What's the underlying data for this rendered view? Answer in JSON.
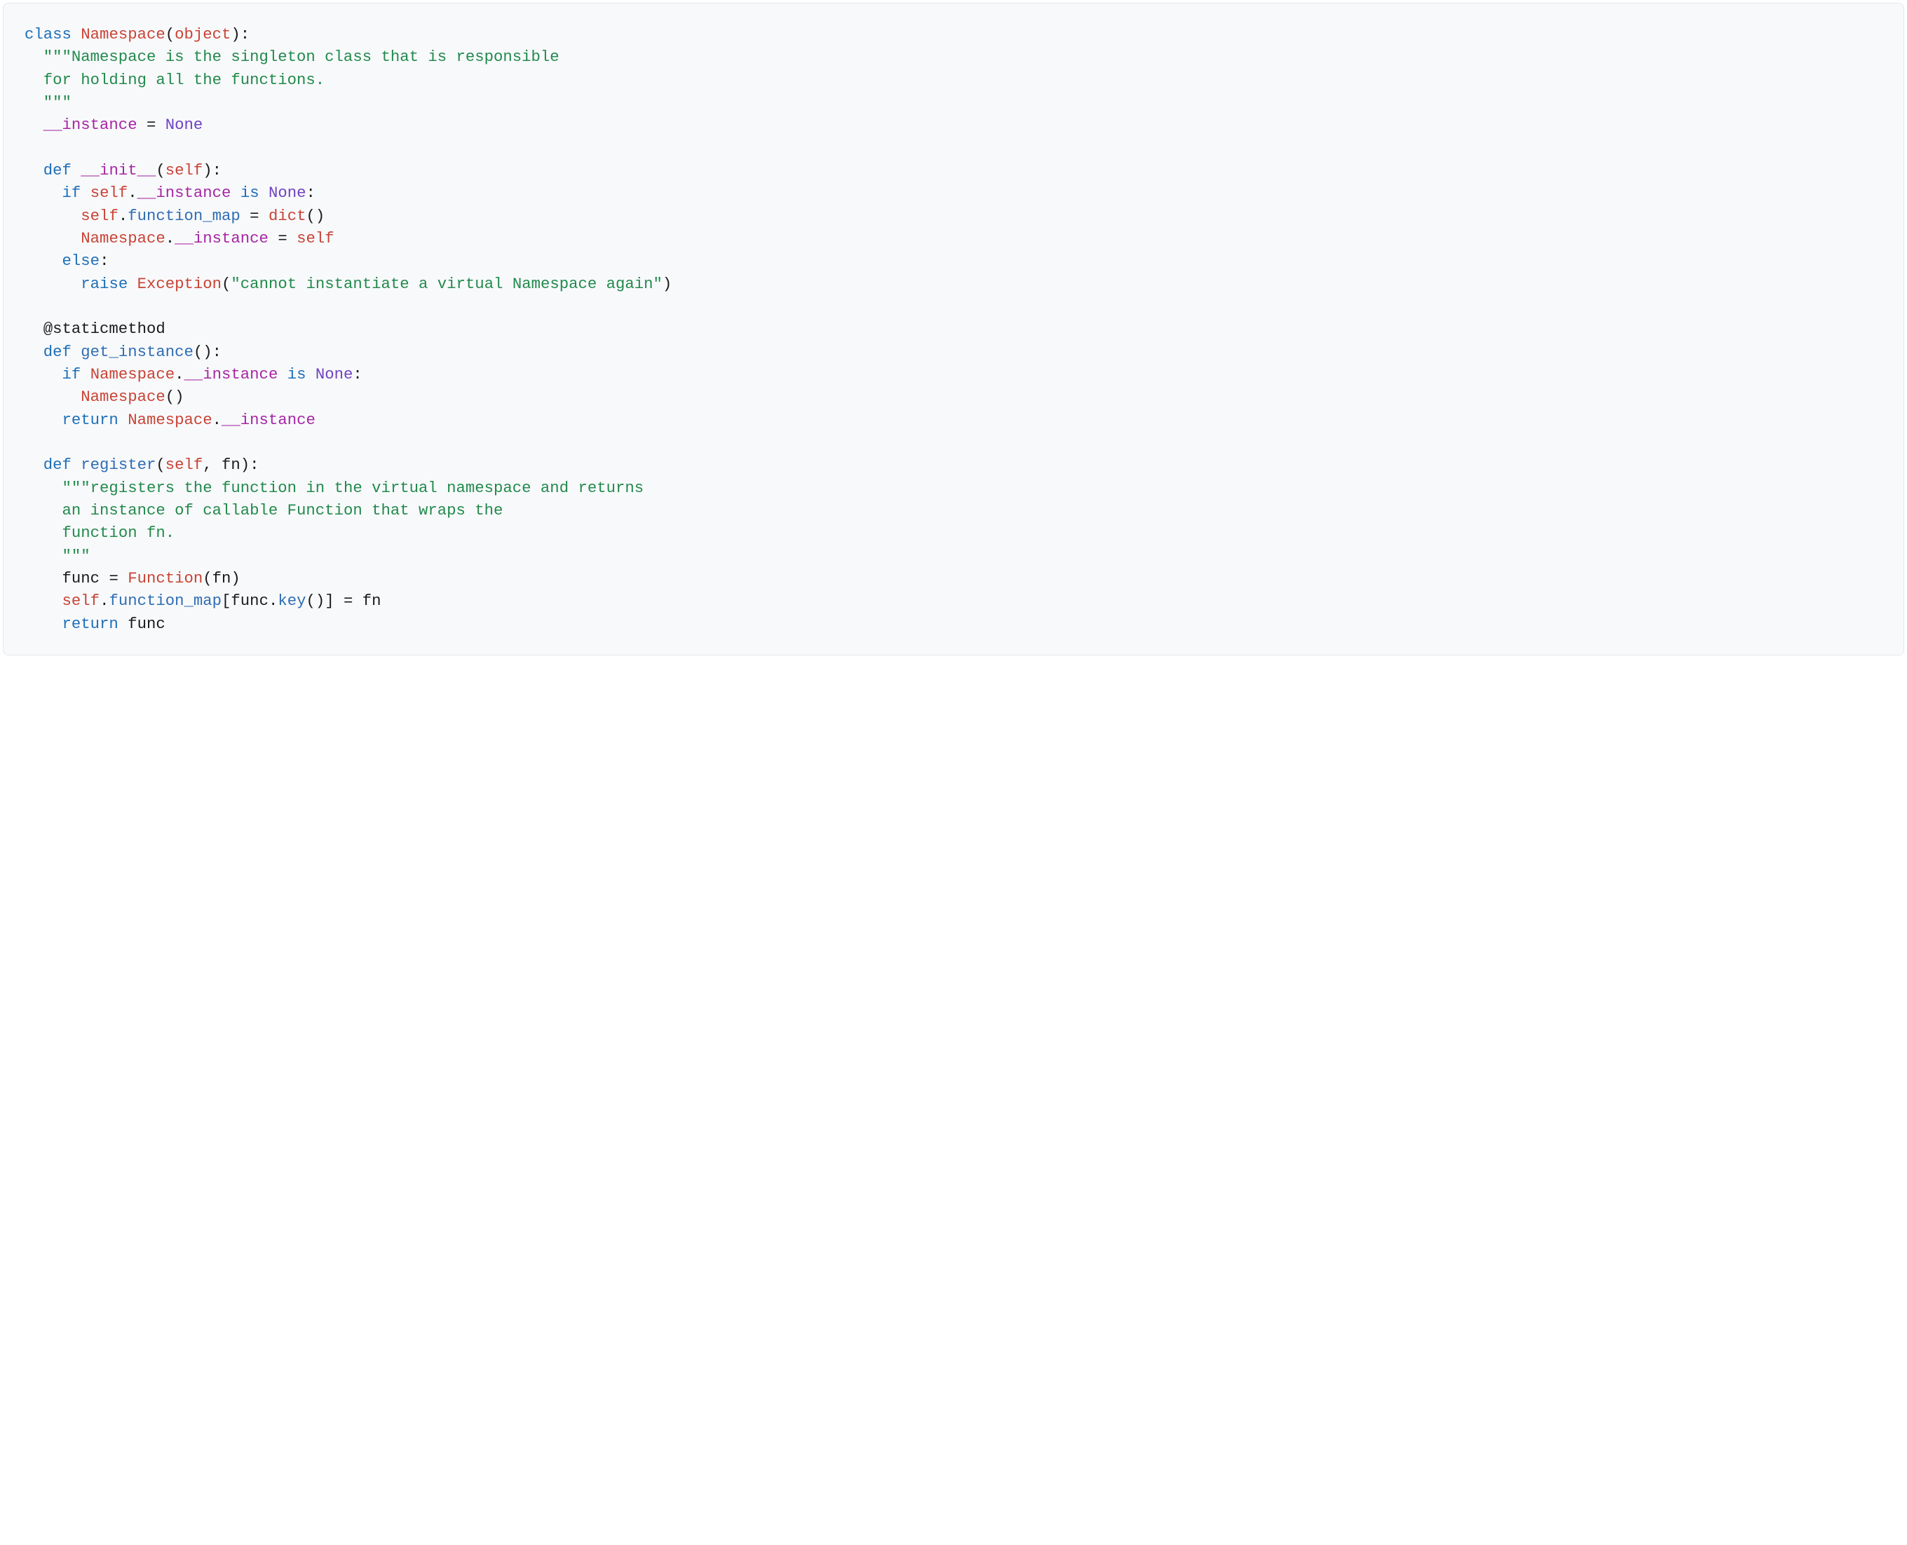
{
  "code": {
    "lines": [
      [
        {
          "t": "class ",
          "c": "kw"
        },
        {
          "t": "Namespace",
          "c": "cls"
        },
        {
          "t": "(",
          "c": "pn"
        },
        {
          "t": "object",
          "c": "bltn"
        },
        {
          "t": "):",
          "c": "pn"
        }
      ],
      [
        {
          "t": "  ",
          "c": "pn"
        },
        {
          "t": "\"\"\"Namespace is the singleton class that is responsible",
          "c": "str"
        }
      ],
      [
        {
          "t": "  ",
          "c": "pn"
        },
        {
          "t": "for holding all the functions.",
          "c": "str"
        }
      ],
      [
        {
          "t": "  ",
          "c": "pn"
        },
        {
          "t": "\"\"\"",
          "c": "str"
        }
      ],
      [
        {
          "t": "  ",
          "c": "pn"
        },
        {
          "t": "__instance",
          "c": "dund"
        },
        {
          "t": " = ",
          "c": "op"
        },
        {
          "t": "None",
          "c": "none"
        }
      ],
      [
        {
          "t": "",
          "c": "pn"
        }
      ],
      [
        {
          "t": "  ",
          "c": "pn"
        },
        {
          "t": "def ",
          "c": "kw"
        },
        {
          "t": "__init__",
          "c": "dund"
        },
        {
          "t": "(",
          "c": "pn"
        },
        {
          "t": "self",
          "c": "self"
        },
        {
          "t": "):",
          "c": "pn"
        }
      ],
      [
        {
          "t": "    ",
          "c": "pn"
        },
        {
          "t": "if ",
          "c": "kw"
        },
        {
          "t": "self",
          "c": "self"
        },
        {
          "t": ".",
          "c": "pn"
        },
        {
          "t": "__instance",
          "c": "dund"
        },
        {
          "t": " ",
          "c": "pn"
        },
        {
          "t": "is",
          "c": "kw"
        },
        {
          "t": " ",
          "c": "pn"
        },
        {
          "t": "None",
          "c": "none"
        },
        {
          "t": ":",
          "c": "pn"
        }
      ],
      [
        {
          "t": "      ",
          "c": "pn"
        },
        {
          "t": "self",
          "c": "self"
        },
        {
          "t": ".",
          "c": "pn"
        },
        {
          "t": "function_map",
          "c": "attr"
        },
        {
          "t": " = ",
          "c": "op"
        },
        {
          "t": "dict",
          "c": "bltn"
        },
        {
          "t": "()",
          "c": "pn"
        }
      ],
      [
        {
          "t": "      ",
          "c": "pn"
        },
        {
          "t": "Namespace",
          "c": "cls"
        },
        {
          "t": ".",
          "c": "pn"
        },
        {
          "t": "__instance",
          "c": "dund"
        },
        {
          "t": " = ",
          "c": "op"
        },
        {
          "t": "self",
          "c": "self"
        }
      ],
      [
        {
          "t": "    ",
          "c": "pn"
        },
        {
          "t": "else",
          "c": "kw"
        },
        {
          "t": ":",
          "c": "pn"
        }
      ],
      [
        {
          "t": "      ",
          "c": "pn"
        },
        {
          "t": "raise ",
          "c": "kw"
        },
        {
          "t": "Exception",
          "c": "bltn"
        },
        {
          "t": "(",
          "c": "pn"
        },
        {
          "t": "\"cannot instantiate a virtual Namespace again\"",
          "c": "str"
        },
        {
          "t": ")",
          "c": "pn"
        }
      ],
      [
        {
          "t": "",
          "c": "pn"
        }
      ],
      [
        {
          "t": "  ",
          "c": "pn"
        },
        {
          "t": "@staticmethod",
          "c": "dec"
        }
      ],
      [
        {
          "t": "  ",
          "c": "pn"
        },
        {
          "t": "def ",
          "c": "kw"
        },
        {
          "t": "get_instance",
          "c": "fn"
        },
        {
          "t": "():",
          "c": "pn"
        }
      ],
      [
        {
          "t": "    ",
          "c": "pn"
        },
        {
          "t": "if ",
          "c": "kw"
        },
        {
          "t": "Namespace",
          "c": "cls"
        },
        {
          "t": ".",
          "c": "pn"
        },
        {
          "t": "__instance",
          "c": "dund"
        },
        {
          "t": " ",
          "c": "pn"
        },
        {
          "t": "is",
          "c": "kw"
        },
        {
          "t": " ",
          "c": "pn"
        },
        {
          "t": "None",
          "c": "none"
        },
        {
          "t": ":",
          "c": "pn"
        }
      ],
      [
        {
          "t": "      ",
          "c": "pn"
        },
        {
          "t": "Namespace",
          "c": "cls"
        },
        {
          "t": "()",
          "c": "pn"
        }
      ],
      [
        {
          "t": "    ",
          "c": "pn"
        },
        {
          "t": "return ",
          "c": "kw"
        },
        {
          "t": "Namespace",
          "c": "cls"
        },
        {
          "t": ".",
          "c": "pn"
        },
        {
          "t": "__instance",
          "c": "dund"
        }
      ],
      [
        {
          "t": "",
          "c": "pn"
        }
      ],
      [
        {
          "t": "  ",
          "c": "pn"
        },
        {
          "t": "def ",
          "c": "kw"
        },
        {
          "t": "register",
          "c": "fn"
        },
        {
          "t": "(",
          "c": "pn"
        },
        {
          "t": "self",
          "c": "self"
        },
        {
          "t": ", ",
          "c": "pn"
        },
        {
          "t": "fn",
          "c": "param"
        },
        {
          "t": "):",
          "c": "pn"
        }
      ],
      [
        {
          "t": "    ",
          "c": "pn"
        },
        {
          "t": "\"\"\"registers the function in the virtual namespace and returns",
          "c": "str"
        }
      ],
      [
        {
          "t": "    ",
          "c": "pn"
        },
        {
          "t": "an instance of callable Function that wraps the",
          "c": "str"
        }
      ],
      [
        {
          "t": "    ",
          "c": "pn"
        },
        {
          "t": "function fn.",
          "c": "str"
        }
      ],
      [
        {
          "t": "    ",
          "c": "pn"
        },
        {
          "t": "\"\"\"",
          "c": "str"
        }
      ],
      [
        {
          "t": "    ",
          "c": "pn"
        },
        {
          "t": "func",
          "c": "param"
        },
        {
          "t": " = ",
          "c": "op"
        },
        {
          "t": "Function",
          "c": "bltn"
        },
        {
          "t": "(",
          "c": "pn"
        },
        {
          "t": "fn",
          "c": "param"
        },
        {
          "t": ")",
          "c": "pn"
        }
      ],
      [
        {
          "t": "    ",
          "c": "pn"
        },
        {
          "t": "self",
          "c": "self"
        },
        {
          "t": ".",
          "c": "pn"
        },
        {
          "t": "function_map",
          "c": "attr"
        },
        {
          "t": "[",
          "c": "pn"
        },
        {
          "t": "func",
          "c": "param"
        },
        {
          "t": ".",
          "c": "pn"
        },
        {
          "t": "key",
          "c": "fn"
        },
        {
          "t": "()] = ",
          "c": "pn"
        },
        {
          "t": "fn",
          "c": "param"
        }
      ],
      [
        {
          "t": "    ",
          "c": "pn"
        },
        {
          "t": "return ",
          "c": "kw"
        },
        {
          "t": "func",
          "c": "param"
        }
      ]
    ]
  }
}
